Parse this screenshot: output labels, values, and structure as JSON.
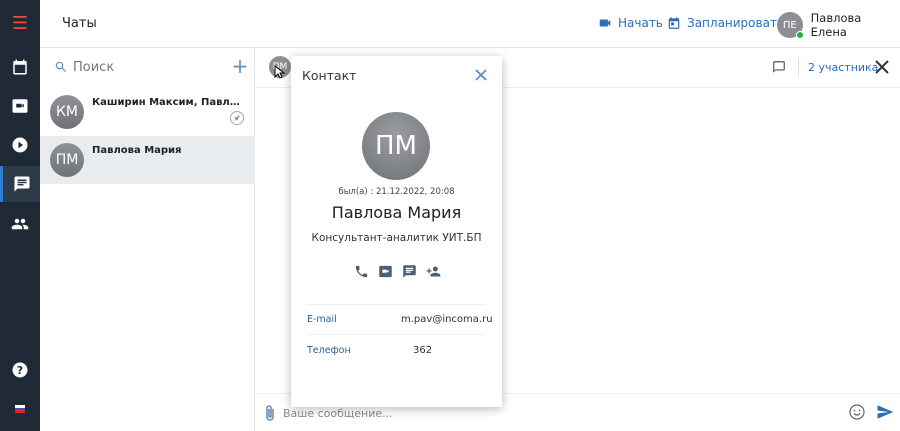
{
  "app": {
    "title": "Чаты"
  },
  "nav": {
    "menu_glyph": "☰",
    "items": [
      {
        "icon": "calendar-icon"
      },
      {
        "icon": "video-icon"
      },
      {
        "icon": "play-icon"
      },
      {
        "icon": "chat-icon",
        "active": true
      },
      {
        "icon": "people-icon"
      }
    ],
    "help_glyph": "?"
  },
  "topbar": {
    "start_label": "Начать",
    "schedule_label": "Запланировать",
    "user": {
      "initials": "ПЕ",
      "name": "Павлова Елена",
      "status_color": "#1fb141"
    }
  },
  "chat_list": {
    "search_placeholder": "Поиск",
    "add_label": "+",
    "items": [
      {
        "initials": "КМ",
        "name": "Каширин Максим, Павлова Мария",
        "pinned": true
      },
      {
        "initials": "ПМ",
        "name": "Павлова Мария",
        "selected": true
      }
    ]
  },
  "chat": {
    "header_initials": "ПМ",
    "participants_label": "2 участника",
    "message_placeholder": "Ваше сообщение..."
  },
  "contact_card": {
    "title": "Контакт",
    "initials": "ПМ",
    "last_seen": "был(а) : 21.12.2022, 20:08",
    "name": "Павлова Мария",
    "position": "Консультант-аналитик УИТ.БП",
    "fields": [
      {
        "label": "E-mail",
        "value": "m.pav@incoma.ru"
      },
      {
        "label": "Телефон",
        "value": "362"
      }
    ]
  },
  "colors": {
    "accent": "#2a6fb8",
    "sidebar_bg": "#1f2a36",
    "menu_icon": "#e5503b"
  }
}
